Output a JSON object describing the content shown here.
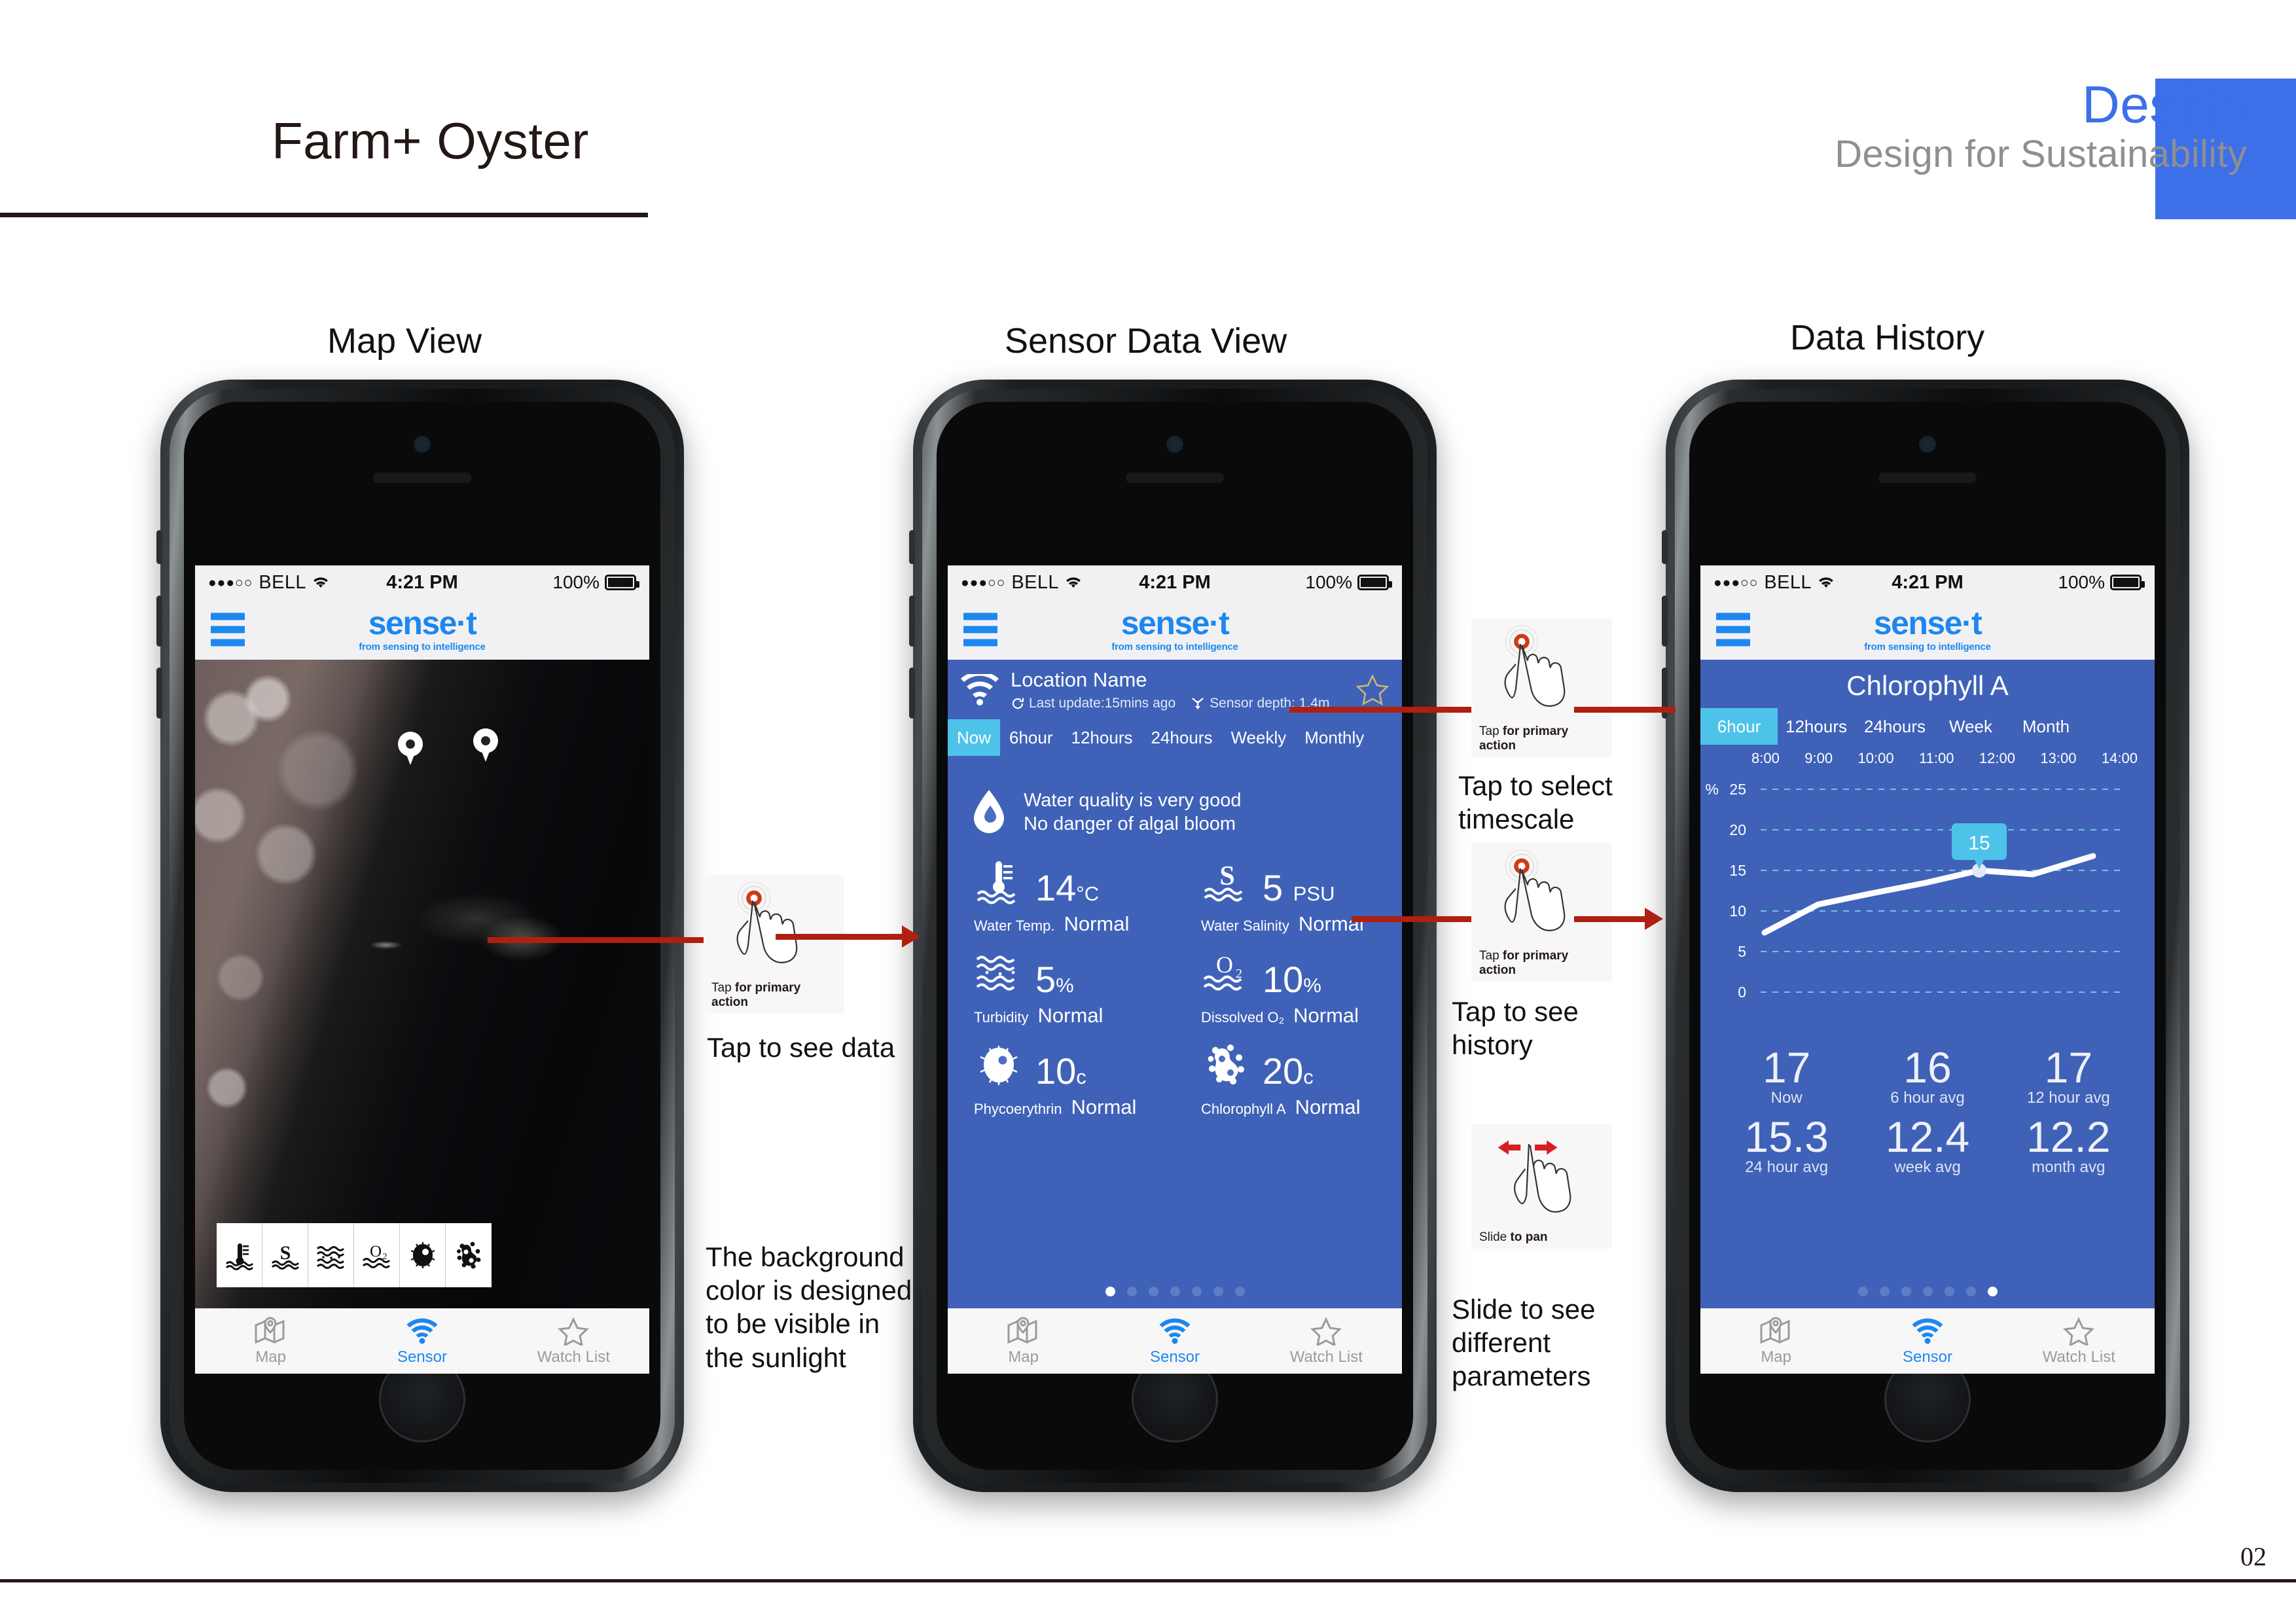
{
  "header": {
    "title": "Farm+ Oyster",
    "design": "Design",
    "subtitle": "Design for Sustainability",
    "accent_color": "#3d6fe8",
    "page_number": "02"
  },
  "view_titles": {
    "map": "Map View",
    "sensor": "Sensor Data View",
    "history": "Data History"
  },
  "status_bar": {
    "dots": "●●●○○",
    "carrier": "BELL",
    "time": "4:21 PM",
    "battery": "100%"
  },
  "brand": {
    "name": "sense·t",
    "tagline": "from sensing to intelligence"
  },
  "tabbar": {
    "items": [
      {
        "label": "Map",
        "icon": "map-pin-icon",
        "active": false
      },
      {
        "label": "Sensor",
        "icon": "wifi-icon",
        "active": true
      },
      {
        "label": "Watch List",
        "icon": "star-icon",
        "active": false
      }
    ]
  },
  "map_view": {
    "parameter_icons": [
      "water-temperature-icon",
      "salinity-icon",
      "turbidity-icon",
      "dissolved-oxygen-icon",
      "phycoerythrin-icon",
      "chlorophyll-icon"
    ],
    "pins": 2
  },
  "sensor_view": {
    "location_name": "Location Name",
    "last_update": "Last update:15mins ago",
    "sensor_depth": "Sensor depth: 1.4m",
    "favourite_icon": "star-outline-icon",
    "timescales": [
      {
        "label": "Now",
        "active": true
      },
      {
        "label": "6hour",
        "active": false
      },
      {
        "label": "12hours",
        "active": false
      },
      {
        "label": "24hours",
        "active": false
      },
      {
        "label": "Weekly",
        "active": false
      },
      {
        "label": "Monthly",
        "active": false
      }
    ],
    "quality_line_1": "Water quality is very good",
    "quality_line_2": "No danger of algal bloom",
    "readings": [
      {
        "icon": "water-temperature-icon",
        "value": "14",
        "unit": "°C",
        "label": "Water Temp.",
        "status": "Normal"
      },
      {
        "icon": "salinity-icon",
        "value": "5",
        "unit": "PSU",
        "label": "Water Salinity",
        "status": "Normal"
      },
      {
        "icon": "turbidity-icon",
        "value": "5",
        "unit": "%",
        "label": "Turbidity",
        "status": "Normal"
      },
      {
        "icon": "dissolved-oxygen-icon",
        "value": "10",
        "unit": "%",
        "label": "Dissolved O₂",
        "status": "Normal"
      },
      {
        "icon": "phycoerythrin-icon",
        "value": "10",
        "unit": "c",
        "label": "Phycoerythrin",
        "status": "Normal"
      },
      {
        "icon": "chlorophyll-icon",
        "value": "20",
        "unit": "c",
        "label": "Chlorophyll A",
        "status": "Normal"
      }
    ],
    "page_dots": {
      "count": 7,
      "active_index": 0
    }
  },
  "history_view": {
    "title": "Chlorophyll A",
    "timescales": [
      {
        "label": "6hour",
        "active": true
      },
      {
        "label": "12hours",
        "active": false
      },
      {
        "label": "24hours",
        "active": false
      },
      {
        "label": "Week",
        "active": false
      },
      {
        "label": "Month",
        "active": false
      }
    ],
    "stats": [
      {
        "value": "17",
        "label": "Now"
      },
      {
        "value": "16",
        "label": "6 hour avg"
      },
      {
        "value": "17",
        "label": "12 hour avg"
      },
      {
        "value": "15.3",
        "label": "24 hour avg"
      },
      {
        "value": "12.4",
        "label": "week avg"
      },
      {
        "value": "12.2",
        "label": "month avg"
      }
    ],
    "page_dots": {
      "count": 7,
      "active_index": 6
    }
  },
  "chart_data": {
    "type": "line",
    "title": "Chlorophyll A",
    "xlabel": "",
    "ylabel": "%",
    "unit": "%",
    "x": [
      "8:00",
      "9:00",
      "10:00",
      "11:00",
      "12:00",
      "13:00",
      "14:00"
    ],
    "categories": [
      "8:00",
      "9:00",
      "10:00",
      "11:00",
      "12:00",
      "13:00",
      "14:00"
    ],
    "values": [
      7.3,
      10.8,
      12.2,
      13.5,
      15.0,
      14.5,
      16.8
    ],
    "series": [
      {
        "name": "Chlorophyll A",
        "values": [
          7.3,
          10.8,
          12.2,
          13.5,
          15.0,
          14.5,
          16.8
        ]
      }
    ],
    "ylim": [
      0,
      25
    ],
    "yticks": [
      0,
      5,
      10,
      15,
      20,
      25
    ],
    "grid": true,
    "legend": "none",
    "annotation": {
      "label": "15",
      "x": "12:00",
      "y": 15
    },
    "line_color": "#ffffff",
    "bg_color": "#3f62b8",
    "tooltip_color": "#4ec3ea"
  },
  "annotations": {
    "tap_caption_light": "Tap",
    "tap_caption_bold": "for primary action",
    "slide_caption_light": "Slide",
    "slide_caption_bold": "to pan",
    "tap_to_see_data": "Tap to see data",
    "background_note": "The background color is designed to be visible in the sunlight",
    "tap_to_select_timescale": "Tap to select timescale",
    "tap_to_see_history": "Tap to see history",
    "slide_to_see_params": "Slide to see different parameters"
  }
}
